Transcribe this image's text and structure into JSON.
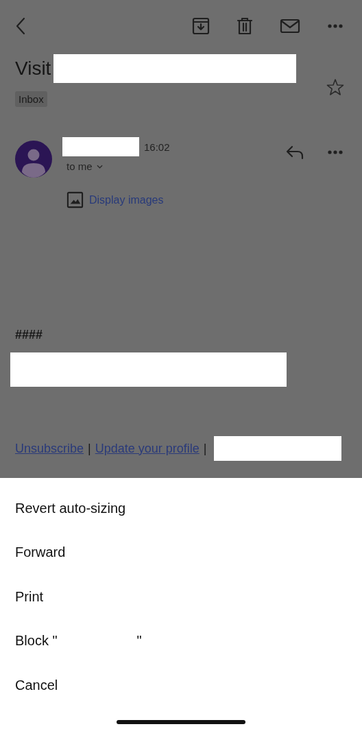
{
  "message": {
    "subject": "Visit",
    "label": "Inbox",
    "starred": false
  },
  "sender": {
    "time": "16:02",
    "recipient": "to me"
  },
  "display_images": "Display images",
  "body": {
    "heading": "####"
  },
  "footer": [
    {
      "kind": "link",
      "text": "Unsubscribe"
    },
    {
      "kind": "separator",
      "text": "|"
    },
    {
      "kind": "link",
      "text": "Update your profile"
    },
    {
      "kind": "separator",
      "text": "|"
    }
  ],
  "action_sheet": {
    "items": [
      {
        "label": "Revert auto-sizing"
      },
      {
        "label": "Forward"
      },
      {
        "label": "Print"
      },
      {
        "label": "Block \"",
        "label_end": "\""
      },
      {
        "label": "Cancel"
      }
    ]
  }
}
